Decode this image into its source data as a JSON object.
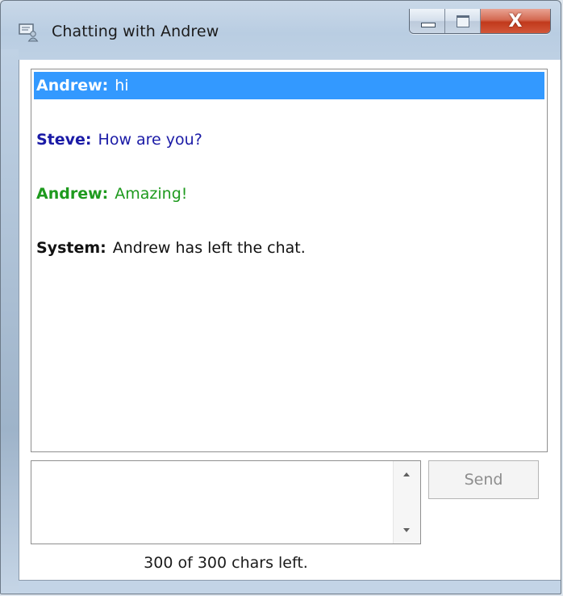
{
  "window": {
    "title": "Chatting with Andrew",
    "icons": {
      "app": "chat-window-icon",
      "minimize": "minimize-icon",
      "maximize": "maximize-icon",
      "close": "close-icon"
    },
    "close_glyph": "X"
  },
  "chat": {
    "messages": [
      {
        "sender": "Andrew:",
        "text": "hi",
        "color": "#ffffff",
        "selected": true
      },
      {
        "sender": "Steve:",
        "text": "How are you?",
        "color": "#1a1aa6",
        "selected": false
      },
      {
        "sender": "Andrew:",
        "text": "Amazing!",
        "color": "#1e9a1e",
        "selected": false
      },
      {
        "sender": "System:",
        "text": "Andrew has left the chat.",
        "color": "#111111",
        "selected": false
      }
    ],
    "selection_color": "#3399ff"
  },
  "composer": {
    "value": "",
    "send_label": "Send",
    "chars_left": "300 of 300 chars left.",
    "icons": {
      "scroll_up": "scroll-up-arrow-icon",
      "scroll_down": "scroll-down-arrow-icon"
    }
  }
}
